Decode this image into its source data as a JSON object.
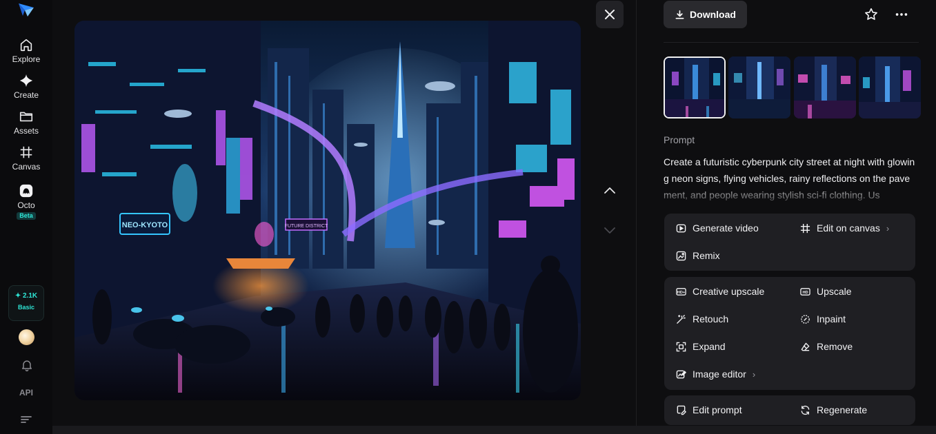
{
  "sidebar": {
    "items": [
      {
        "label": "Explore",
        "icon": "home-icon"
      },
      {
        "label": "Create",
        "icon": "sparkle-icon"
      },
      {
        "label": "Assets",
        "icon": "folder-icon"
      },
      {
        "label": "Canvas",
        "icon": "canvas-icon"
      },
      {
        "label": "Octo",
        "icon": "octo-icon",
        "badge": "Beta"
      }
    ],
    "credits": {
      "amount": "✦ 2.1K",
      "plan": "Basic"
    },
    "api_label": "API"
  },
  "viewer": {
    "image_alt": "Futuristic cyberpunk city street at night",
    "sign_text": "NEO-KYOTO",
    "sign_text_2": "FUTURE DISTRICT"
  },
  "panel": {
    "download_label": "Download",
    "prompt_label": "Prompt",
    "prompt_text": "Create a futuristic cyberpunk city street at night with glowing neon signs, flying vehicles, rainy reflections on the pavement, and people wearing stylish sci-fi clothing. Us",
    "actions_group1": [
      {
        "label": "Generate video",
        "icon": "video-icon"
      },
      {
        "label": "Edit on canvas",
        "icon": "canvas-icon",
        "chevron": true
      },
      {
        "label": "Remix",
        "icon": "remix-icon"
      }
    ],
    "actions_group2": [
      {
        "label": "Creative upscale",
        "icon": "hd-plus-icon"
      },
      {
        "label": "Upscale",
        "icon": "hd-icon"
      },
      {
        "label": "Retouch",
        "icon": "wand-icon"
      },
      {
        "label": "Inpaint",
        "icon": "inpaint-icon"
      },
      {
        "label": "Expand",
        "icon": "expand-icon"
      },
      {
        "label": "Remove",
        "icon": "eraser-icon"
      },
      {
        "label": "Image editor",
        "icon": "image-edit-icon",
        "chevron": true
      }
    ],
    "actions_group3": [
      {
        "label": "Edit prompt",
        "icon": "edit-prompt-icon"
      },
      {
        "label": "Regenerate",
        "icon": "refresh-icon"
      }
    ]
  },
  "colors": {
    "accent": "#2ee6d6",
    "panel_card": "#1f1f23",
    "background": "#0e0e10"
  }
}
